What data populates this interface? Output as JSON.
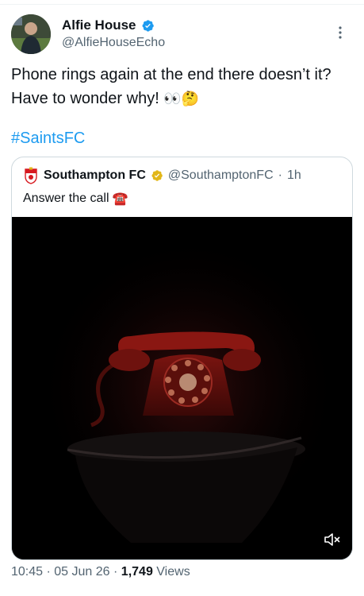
{
  "author": {
    "display_name": "Alfie House",
    "handle": "@AlfieHouseEcho",
    "verified_color": "#1d9bf0",
    "avatar": "profile-photo"
  },
  "tweet": {
    "text": "Phone rings again at the end there doesn’t it? Have to wonder why!",
    "emoji_eyes": "👀",
    "emoji_thinking": "🤔",
    "hashtag": "#SaintsFC"
  },
  "quoted": {
    "display_name": "Southampton FC",
    "handle": "@SouthamptonFC",
    "separator": "·",
    "age": "1h",
    "text": "Answer the call",
    "emoji_phone": "☎️",
    "verified_color": "#e2b719",
    "media": "video-red-rotary-telephone"
  },
  "meta": {
    "time": "10:45",
    "date": "05 Jun 26",
    "dot": "·",
    "views_count": "1,749",
    "views_label": "Views"
  },
  "colors": {
    "link": "#1d9bf0",
    "secondary": "#536471",
    "primary": "#0f1419",
    "border": "#cfd9de"
  }
}
